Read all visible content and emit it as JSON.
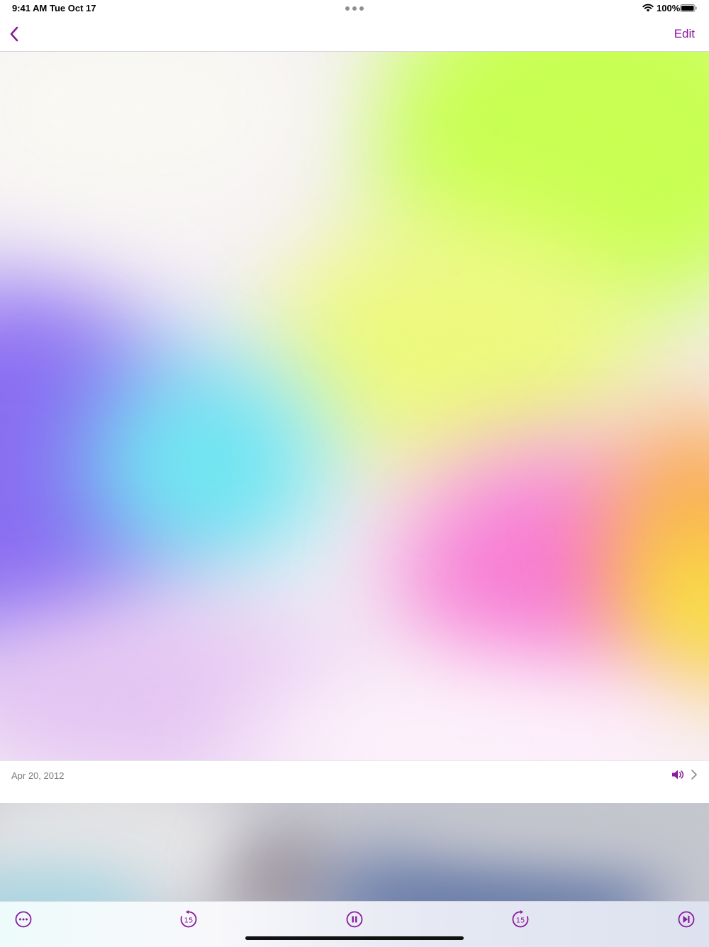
{
  "status_bar": {
    "time": "9:41 AM",
    "date": "Tue Oct 17",
    "battery_percent": "100%",
    "icons": [
      "multitasking-dots-icon",
      "wifi-icon",
      "battery-icon"
    ]
  },
  "nav": {
    "back_icon": "chevron-left-icon",
    "edit_label": "Edit"
  },
  "info": {
    "date": "Apr 20, 2012",
    "icons": [
      "speaker-icon",
      "chevron-right-icon"
    ]
  },
  "controls": {
    "skip_back_seconds": "15",
    "skip_forward_seconds": "15",
    "icons": [
      "more-icon",
      "skip-back-15-icon",
      "pause-icon",
      "skip-forward-15-icon",
      "next-track-icon"
    ]
  },
  "colors": {
    "accent": "#8a1a9e",
    "background": "#ffffff"
  }
}
